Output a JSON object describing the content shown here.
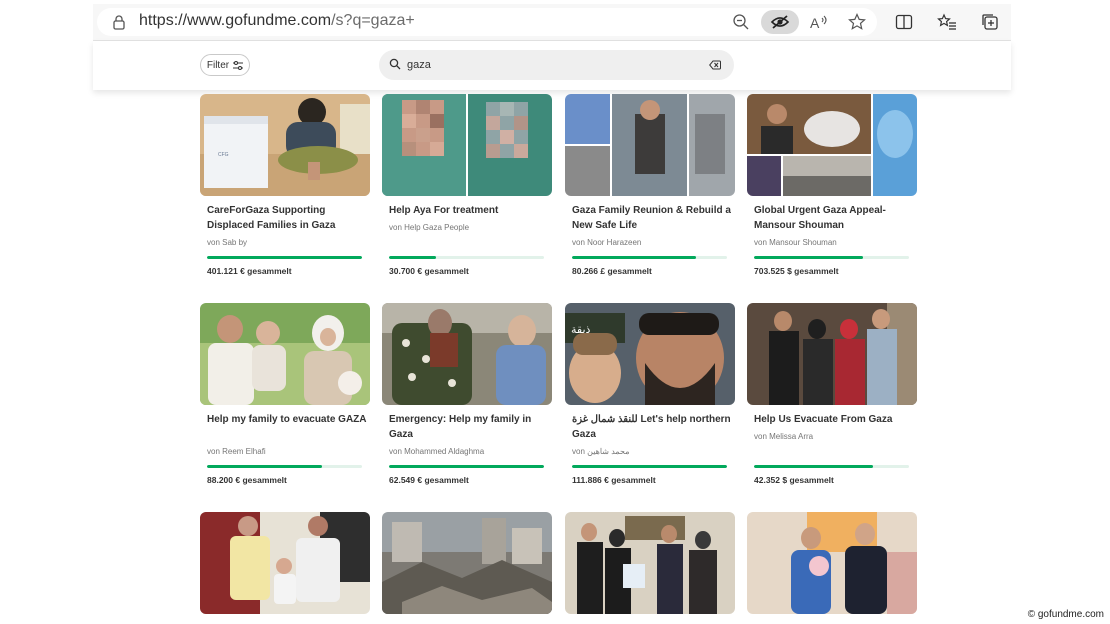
{
  "browser": {
    "url_main": "https://www.gofundme.com",
    "url_path": "/s?q=gaza+"
  },
  "header": {
    "filter_label": "Filter",
    "search_value": "gaza"
  },
  "cards": [
    {
      "title": "CareForGaza Supporting Displaced Families in Gaza",
      "org": "von Sab by",
      "amount": "401.121 € gesammelt",
      "progress": 1.0
    },
    {
      "title": "Help Aya For treatment",
      "org": "von Help Gaza People",
      "amount": "30.700 € gesammelt",
      "progress": 0.3
    },
    {
      "title": "Gaza Family Reunion & Rebuild a New Safe Life",
      "org": "von Noor Harazeen",
      "amount": "80.266 £ gesammelt",
      "progress": 0.8
    },
    {
      "title": "Global Urgent Gaza Appeal- Mansour Shouman",
      "org": "von Mansour Shouman",
      "amount": "703.525 $ gesammelt",
      "progress": 0.7
    },
    {
      "title": "Help my family to evacuate GAZA",
      "org": "von Reem Elhafi",
      "amount": "88.200 € gesammelt",
      "progress": 0.74
    },
    {
      "title": "Emergency: Help my family in Gaza",
      "org": "von Mohammed Aldaghma",
      "amount": "62.549 € gesammelt",
      "progress": 1.0
    },
    {
      "title": "للنقذ شمال غزة Let's help northern Gaza",
      "org": "von محمد شاهين",
      "amount": "111.886 € gesammelt",
      "progress": 1.0
    },
    {
      "title": "Help Us Evacuate From Gaza",
      "org": "von Melissa Arra",
      "amount": "42.352 $ gesammelt",
      "progress": 0.77
    },
    {
      "title": "",
      "org": "",
      "amount": "",
      "progress": 0
    },
    {
      "title": "",
      "org": "",
      "amount": "",
      "progress": 0
    },
    {
      "title": "",
      "org": "",
      "amount": "",
      "progress": 0
    },
    {
      "title": "",
      "org": "",
      "amount": "",
      "progress": 0
    }
  ],
  "copyright": "© gofundme.com",
  "colors": {
    "accent": "#02a95c",
    "track": "#e2f2ea"
  }
}
